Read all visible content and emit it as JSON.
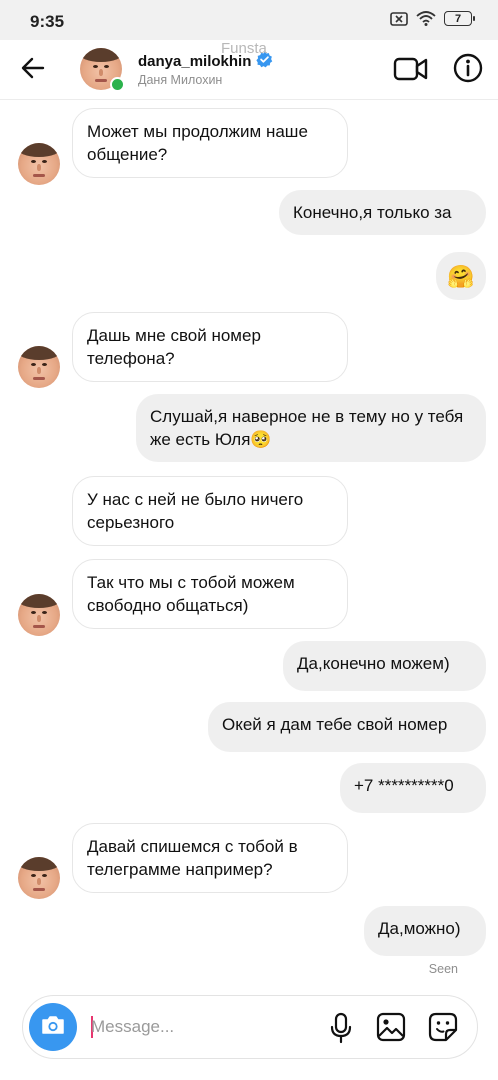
{
  "status": {
    "time": "9:35",
    "battery": "7"
  },
  "header": {
    "username": "danya_milokhin",
    "full_name": "Даня Милохин",
    "watermark": "Funsta"
  },
  "messages": [
    {
      "side": "in",
      "text": "Может мы продолжим наше общение?"
    },
    {
      "side": "out",
      "text": "Конечно,я только за"
    },
    {
      "side": "out",
      "text": "🤗"
    },
    {
      "side": "in",
      "text": "Дашь мне свой номер телефона?"
    },
    {
      "side": "out",
      "text": "Слушай,я наверное не в тему но у тебя же есть Юля🥺"
    },
    {
      "side": "in",
      "text": "У нас с ней не было ничего серьезного"
    },
    {
      "side": "in",
      "text": "Так что мы с тобой можем свободно общаться)"
    },
    {
      "side": "out",
      "text": "Да,конечно можем)"
    },
    {
      "side": "out",
      "text": "Окей я дам тебе свой номер"
    },
    {
      "side": "out",
      "text": "+7 **********0"
    },
    {
      "side": "in",
      "text": "Давай спишемся с тобой в телеграмме например?"
    },
    {
      "side": "out",
      "text": "Да,можно)"
    }
  ],
  "seen_label": "Seen",
  "composer": {
    "placeholder": "Message..."
  },
  "colors": {
    "accent": "#3897f0",
    "online": "#2bb24c",
    "verified": "#3897f0",
    "incoming_bg": "#ffffff",
    "outgoing_bg": "#efefef"
  },
  "icons": [
    "back-arrow-icon",
    "verified-badge-icon",
    "video-camera-icon",
    "info-icon",
    "camera-icon",
    "microphone-icon",
    "gallery-icon",
    "sticker-icon"
  ]
}
